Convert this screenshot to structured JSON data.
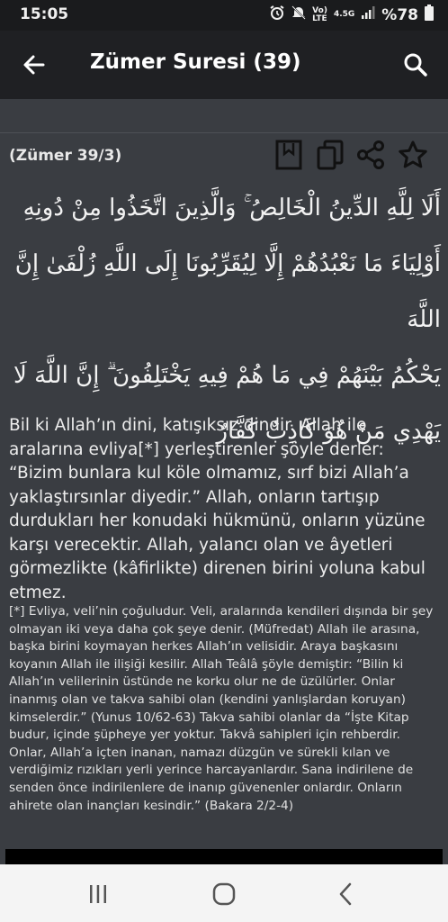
{
  "status_bar": {
    "time": "15:05",
    "network_top": "Vo)",
    "network_bottom": "LTE",
    "network_speed": "4.5G",
    "battery": "%78"
  },
  "app_bar": {
    "title": "Zümer Suresi (39)",
    "back_icon": "arrow-left-icon",
    "search_icon": "search-icon"
  },
  "verse": {
    "reference": "(Zümer 39/3)",
    "actions": [
      "bookmark-icon",
      "copy-icon",
      "share-icon",
      "star-icon"
    ],
    "arabic_lines": [
      "أَلَا لِلَّهِ الدِّينُ الْخَالِصُ ۚ وَالَّذِينَ اتَّخَذُوا مِنْ دُونِهِ",
      "أَوْلِيَاءَ مَا نَعْبُدُهُمْ إِلَّا لِيُقَرِّبُونَا إِلَى اللَّهِ زُلْفَىٰ إِنَّ اللَّهَ",
      "يَحْكُمُ بَيْنَهُمْ فِي مَا هُمْ فِيهِ يَخْتَلِفُونَ ۗ إِنَّ اللَّهَ لَا",
      "يَهْدِي مَنْ هُوَ كَاذِبٌ كَفَّارٌ"
    ],
    "translation": "Bil ki Allah’ın dini, katışıksız dindir. Allah ile aralarına evliya[*] yerleştirenler şöyle derler: “Bizim bunlara kul köle olmamız, sırf bizi Allah’a yaklaştırsınlar diyedir.” Allah, onların tartışıp durdukları her konudaki hükmünü, onların yüzüne karşı verecektir. Allah, yalancı olan ve âyetleri görmezlikte (kâfirlikte) direnen birini yoluna kabul etmez.",
    "footnote": " [*] Evliya, veli’nin çoğuludur. Veli, aralarında kendileri dışında bir şey olmayan iki veya daha çok şeye denir. (Müfredat) Allah ile arasına, başka birini koymayan herkes Allah’ın velisidir. Araya başkasını koyanın Allah ile ilişiği kesilir. Allah Teâlâ şöyle demiştir: “Bilin ki Allah’ın velilerinin üstünde ne korku olur ne de üzülürler. Onlar inanmış olan ve takva sahibi olan (kendini yanlışlardan koruyan) kimselerdir.” (Yunus 10/62-63) Takva sahibi olanlar da “İşte Kitap budur, içinde şüpheye yer yoktur. Takvâ sahipleri için rehberdir. Onlar, Allah’a içten inanan, namazı düzgün ve sürekli kılan ve verdiğimiz rızıkları yerli yerince harcayanlardır. Sana indirilene de senden önce indirilenlere de inanıp güvenenler onlardır. Onların ahirete olan inançları kesindir.” (Bakara 2/2-4)"
  },
  "nav_bar": {
    "buttons": [
      "recent-apps-icon",
      "home-icon",
      "back-icon"
    ]
  },
  "colors": {
    "background": "#3a3d42",
    "app_bar": "#1f2023",
    "status_bar": "#1a1b1d",
    "text": "#e6e6e6",
    "nav_bar": "#f4f4f4"
  }
}
